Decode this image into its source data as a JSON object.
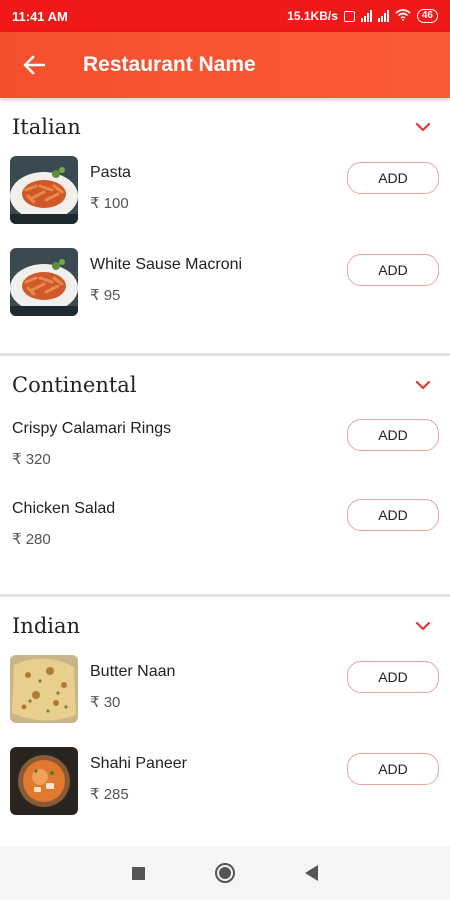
{
  "status_bar": {
    "time": "11:41 AM",
    "speed": "15.1KB/s",
    "battery": "46"
  },
  "app_bar": {
    "title": "Restaurant Name",
    "back_icon": "arrow-left-icon"
  },
  "sections": [
    {
      "title": "Italian",
      "items": [
        {
          "name": "Pasta",
          "price": "₹ 100",
          "add_label": "ADD",
          "image": "pasta"
        },
        {
          "name": "White Sause Macroni",
          "price": "₹ 95",
          "add_label": "ADD",
          "image": "pasta"
        }
      ]
    },
    {
      "title": "Continental",
      "items": [
        {
          "name": "Crispy Calamari Rings",
          "price": "₹ 320",
          "add_label": "ADD"
        },
        {
          "name": "Chicken Salad",
          "price": "₹ 280",
          "add_label": "ADD"
        }
      ]
    },
    {
      "title": "Indian",
      "items": [
        {
          "name": "Butter Naan",
          "price": "₹ 30",
          "add_label": "ADD",
          "image": "naan"
        },
        {
          "name": "Shahi Paneer",
          "price": "₹ 285",
          "add_label": "ADD",
          "image": "curry"
        }
      ]
    }
  ],
  "colors": {
    "status_bar": "#f01818",
    "app_bar": "#fb5a36",
    "chevron": "#e53935",
    "add_border": "#e7a7a3"
  }
}
